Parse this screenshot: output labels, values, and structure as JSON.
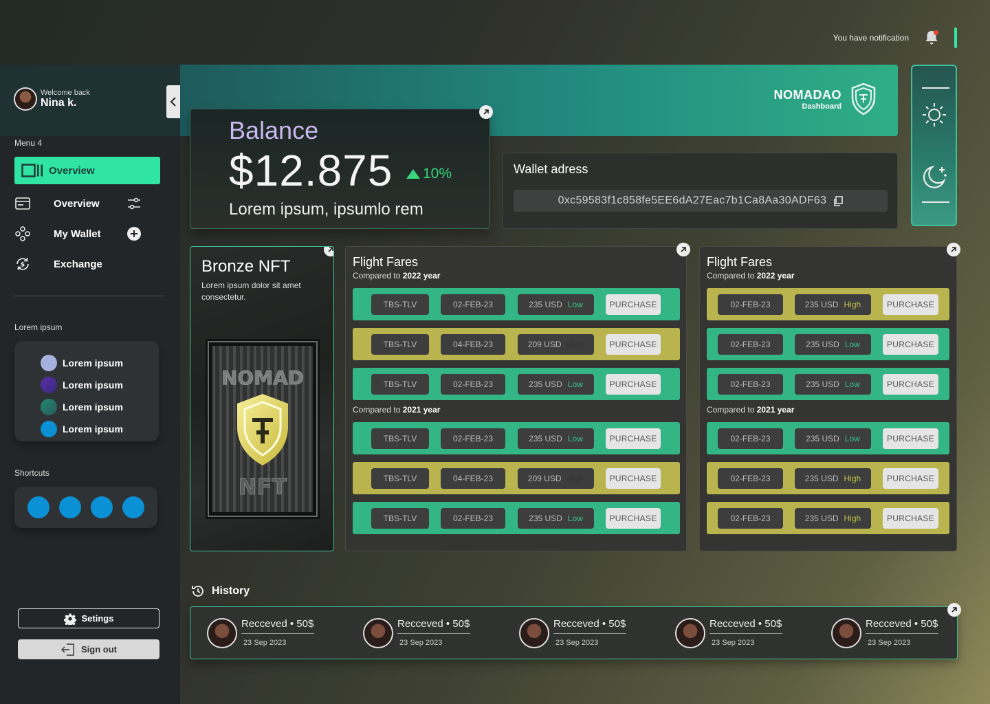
{
  "notification": {
    "text": "You have notification"
  },
  "sidebar": {
    "welcome": "Welcome back",
    "user_name": "Nina k.",
    "menu_label": "Menu 4",
    "active_item": "Overview",
    "items": [
      {
        "label": "Overview",
        "icon": "card-icon",
        "right_icon": "sliders-icon"
      },
      {
        "label": "My Wallet",
        "icon": "coins-icon",
        "right_icon": "plus-circle-icon"
      },
      {
        "label": "Exchange",
        "icon": "exchange-icon"
      }
    ],
    "lorem_label": "Lorem ipsum",
    "lorem_items": [
      {
        "label": "Lorem ipsum",
        "color": "#a7b1e0"
      },
      {
        "label": "Lorem ipsum",
        "color": "#5a2ea8"
      },
      {
        "label": "Lorem ipsum",
        "color": "#1f8a6c"
      },
      {
        "label": "Lorem ipsum",
        "color": "#0a90d4"
      }
    ],
    "shortcuts_label": "Shortcuts",
    "shortcut_color": "#0a90d4",
    "settings_label": "Setings",
    "signout_label": "Sign out"
  },
  "banner": {
    "brand_name": "NOMADAO",
    "brand_sub": "Dashboard"
  },
  "balance": {
    "title": "Balance",
    "amount": "$12.875",
    "change": "10%",
    "subtitle": "Lorem ipsum, ipsumlo rem"
  },
  "wallet": {
    "title": "Wallet adress",
    "address": "0xc59583f1c858fe5EE6dA27Eac7b1Ca8Aa30ADF63"
  },
  "nft": {
    "title": "Bronze NFT",
    "description": "Lorem ipsum dolor sit amet consectetur.",
    "image_text_top": "NOMAD",
    "image_text_bottom": "NFT"
  },
  "fares_left": {
    "title": "Flight Fares",
    "compare_prefix": "Compared to",
    "year_a": "2022 year",
    "year_b": "2021 year",
    "rows_a": [
      {
        "color": "green",
        "route": "TBS-TLV",
        "date": "02-FEB-23",
        "price": "235 USD",
        "level": "Low",
        "button": "PURCHASE"
      },
      {
        "color": "yellow",
        "route": "TBS-TLV",
        "date": "04-FEB-23",
        "price": "209 USD",
        "level": "High",
        "button": "PURCHASE"
      },
      {
        "color": "green",
        "route": "TBS-TLV",
        "date": "02-FEB-23",
        "price": "235 USD",
        "level": "Low",
        "button": "PURCHASE"
      }
    ],
    "rows_b": [
      {
        "color": "green",
        "route": "TBS-TLV",
        "date": "02-FEB-23",
        "price": "235 USD",
        "level": "Low",
        "button": "PURCHASE"
      },
      {
        "color": "yellow",
        "route": "TBS-TLV",
        "date": "04-FEB-23",
        "price": "209 USD",
        "level": "High",
        "button": "PURCHASE"
      },
      {
        "color": "green",
        "route": "TBS-TLV",
        "date": "02-FEB-23",
        "price": "235 USD",
        "level": "Low",
        "button": "PURCHASE"
      }
    ]
  },
  "fares_right": {
    "title": "Flight Fares",
    "compare_prefix": "Compared to",
    "year_a": "2022 year",
    "year_b": "2021 year",
    "rows_a": [
      {
        "color": "yellow",
        "date": "02-FEB-23",
        "price": "235 USD",
        "level": "High",
        "button": "PURCHASE"
      },
      {
        "color": "green",
        "date": "02-FEB-23",
        "price": "235 USD",
        "level": "Low",
        "button": "PURCHASE"
      },
      {
        "color": "green",
        "date": "02-FEB-23",
        "price": "235 USD",
        "level": "Low",
        "button": "PURCHASE"
      }
    ],
    "rows_b": [
      {
        "color": "green",
        "date": "02-FEB-23",
        "price": "235 USD",
        "level": "Low",
        "button": "PURCHASE"
      },
      {
        "color": "yellow",
        "date": "02-FEB-23",
        "price": "235 USD",
        "level": "High",
        "button": "PURCHASE"
      },
      {
        "color": "yellow",
        "date": "02-FEB-23",
        "price": "235 USD",
        "level": "High",
        "button": "PURCHASE"
      }
    ]
  },
  "history": {
    "title": "History",
    "items": [
      {
        "label": "Recceved • 50$",
        "date": "23 Sep 2023"
      },
      {
        "label": "Recceved • 50$",
        "date": "23 Sep 2023"
      },
      {
        "label": "Recceved • 50$",
        "date": "23 Sep 2023"
      },
      {
        "label": "Recceved • 50$",
        "date": "23 Sep 2023"
      },
      {
        "label": "Recceved • 50$",
        "date": "23 Sep 2023"
      }
    ]
  },
  "colors": {
    "accent": "#30e5a4",
    "fare_green": "#33b586",
    "fare_yellow": "#b9b44e",
    "gain": "#36d77e"
  }
}
